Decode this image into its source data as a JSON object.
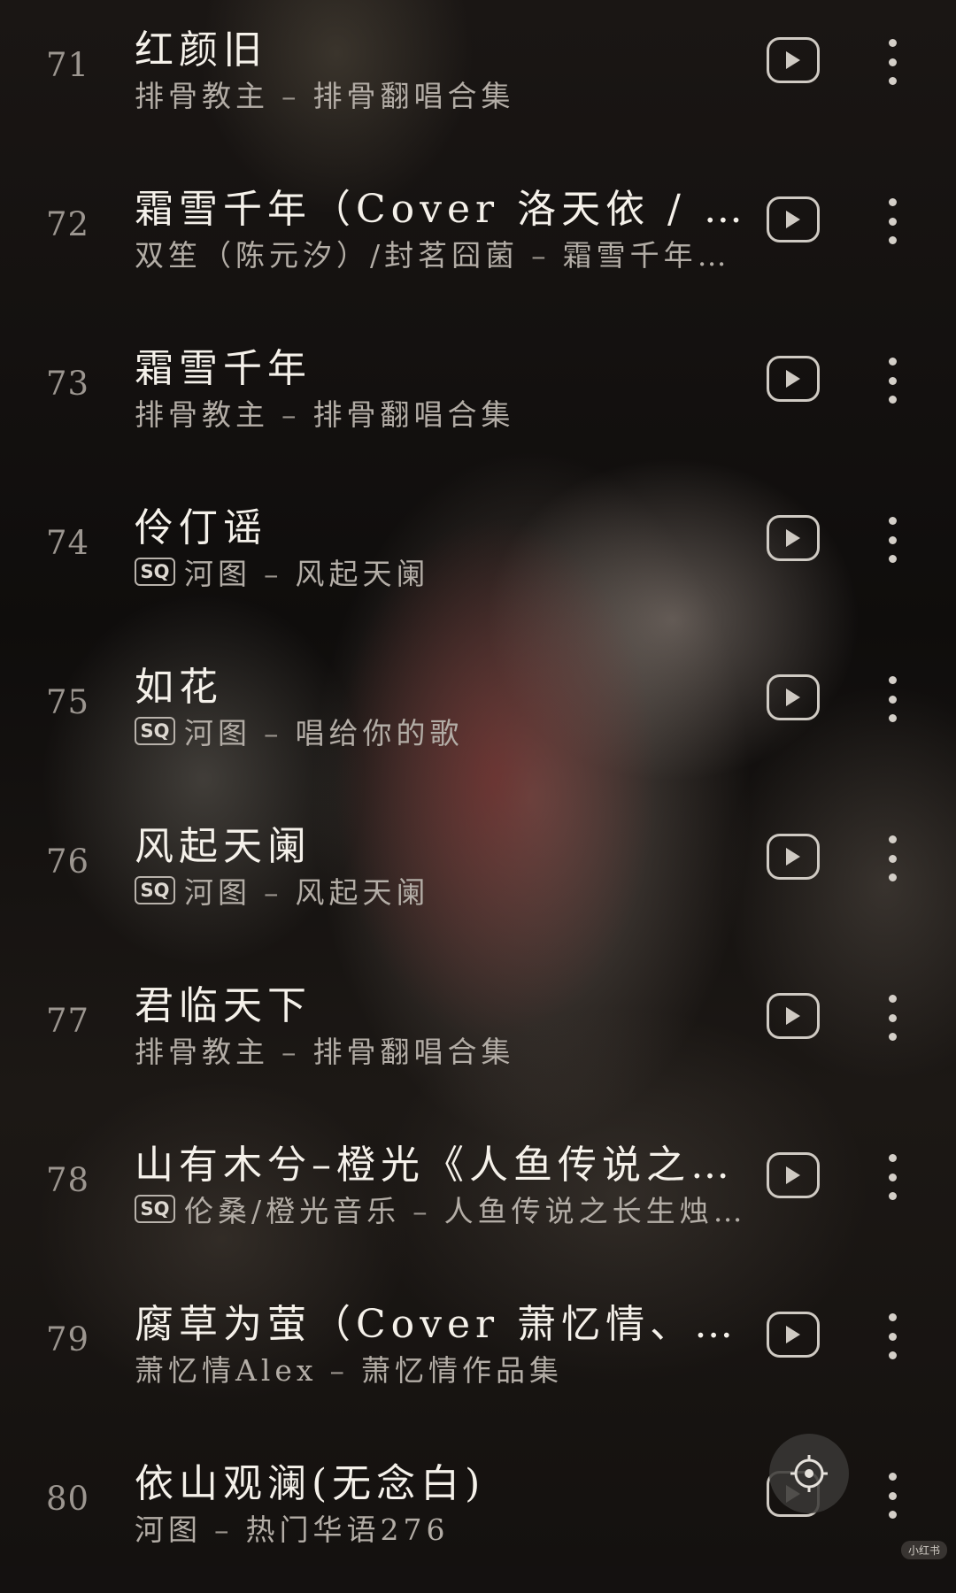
{
  "songs": [
    {
      "index": "71",
      "title": "红颜旧",
      "badge": "",
      "artist": "排骨教主",
      "separator": "–",
      "album": "排骨翻唱合集"
    },
    {
      "index": "72",
      "title": "霜雪千年（Cover 洛天依 / 乐正…",
      "badge": "",
      "artist": "双笙（陈元汐）/封茗囧菌",
      "separator": "–",
      "album": "霜雪千年（…"
    },
    {
      "index": "73",
      "title": "霜雪千年",
      "badge": "",
      "artist": "排骨教主",
      "separator": "–",
      "album": "排骨翻唱合集"
    },
    {
      "index": "74",
      "title": "伶仃谣",
      "badge": "SQ",
      "artist": "河图",
      "separator": "–",
      "album": "风起天阑"
    },
    {
      "index": "75",
      "title": "如花",
      "badge": "SQ",
      "artist": "河图",
      "separator": "–",
      "album": "唱给你的歌"
    },
    {
      "index": "76",
      "title": "风起天阑",
      "badge": "SQ",
      "artist": "河图",
      "separator": "–",
      "album": "风起天阑"
    },
    {
      "index": "77",
      "title": "君临天下",
      "badge": "",
      "artist": "排骨教主",
      "separator": "–",
      "album": "排骨翻唱合集"
    },
    {
      "index": "78",
      "title": "山有木兮–橙光《人鱼传说之长…",
      "badge": "SQ",
      "artist": "伦桑/橙光音乐",
      "separator": "–",
      "album": "人鱼传说之长生烛…"
    },
    {
      "index": "79",
      "title": "腐草为萤（Cover 萧忆情、哦漏）",
      "badge": "",
      "artist": "萧忆情Alex",
      "separator": "–",
      "album": "萧忆情作品集"
    },
    {
      "index": "80",
      "title": "依山观澜(无念白)",
      "badge": "",
      "artist": "河图",
      "separator": "–",
      "album": "热门华语276"
    }
  ],
  "icons": {
    "play": "play-video-icon",
    "more": "more-vertical-icon",
    "float": "locate-current-song-icon"
  },
  "watermark": "小红书",
  "colors": {
    "title": "#f5f1ea",
    "subtitle": "#b3ada6",
    "index": "#9c9690",
    "icon": "#cfcac3"
  }
}
